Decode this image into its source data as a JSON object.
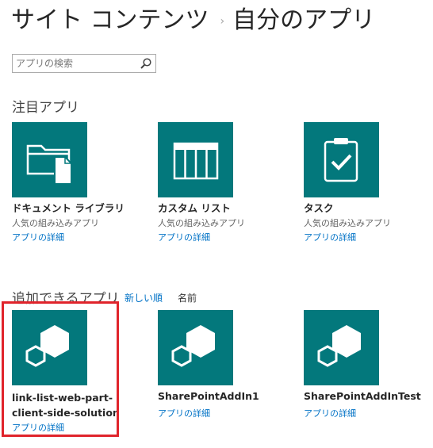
{
  "breadcrumb": {
    "root": "サイト コンテンツ",
    "separator": "›",
    "current": "自分のアプリ"
  },
  "search": {
    "placeholder": "アプリの検索",
    "icon": "search-icon"
  },
  "featured": {
    "title": "注目アプリ",
    "apps": [
      {
        "name": "ドキュメント ライブラリ",
        "subtitle": "人気の組み込みアプリ",
        "details": "アプリの詳細",
        "icon": "document-library-icon"
      },
      {
        "name": "カスタム リスト",
        "subtitle": "人気の組み込みアプリ",
        "details": "アプリの詳細",
        "icon": "custom-list-icon"
      },
      {
        "name": "タスク",
        "subtitle": "人気の組み込みアプリ",
        "details": "アプリの詳細",
        "icon": "tasks-icon"
      }
    ]
  },
  "available": {
    "title": "追加できるアプリ",
    "sort_newest": "新しい順",
    "sort_name": "名前",
    "apps": [
      {
        "name": "link-list-web-part-client-side-solution",
        "details": "アプリの詳細",
        "icon": "app-package-icon"
      },
      {
        "name": "SharePointAddIn1",
        "details": "アプリの詳細",
        "icon": "app-package-icon"
      },
      {
        "name": "SharePointAddInTest",
        "details": "アプリの詳細",
        "icon": "app-package-icon"
      }
    ]
  },
  "colors": {
    "tile": "#03787c",
    "link": "#0072c6",
    "highlight": "#e0242b"
  }
}
